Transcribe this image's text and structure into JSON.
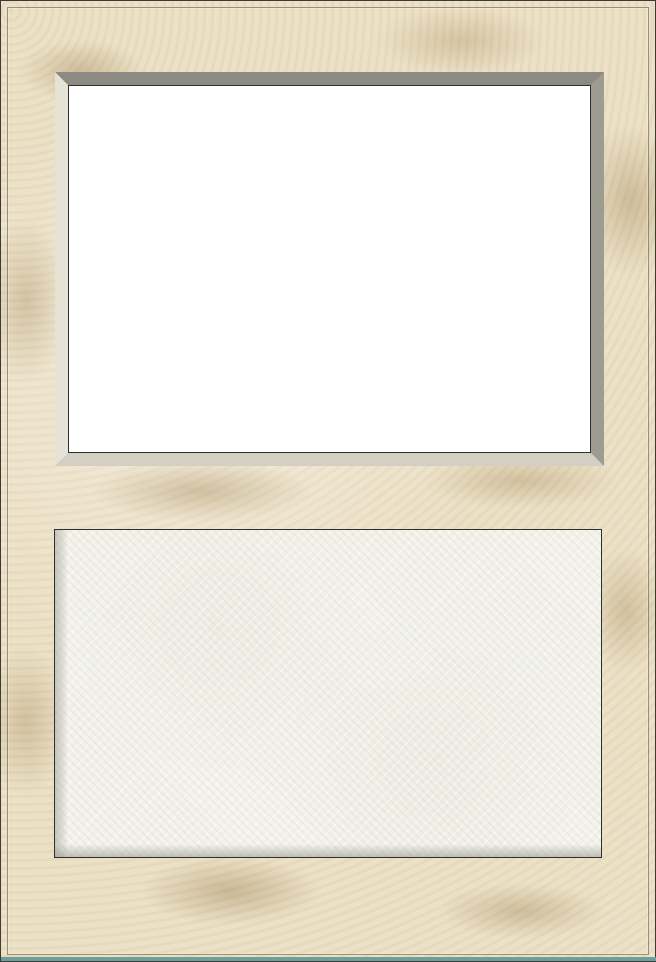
{
  "card": {
    "border_color": "#3a3a36",
    "background_color": "#ece1c7",
    "accent_strip_color": "#6f9f98"
  },
  "photo_frame": {
    "fill_color": "#ffffff"
  },
  "text_panel": {
    "fill_color": "#f3f2ea"
  }
}
